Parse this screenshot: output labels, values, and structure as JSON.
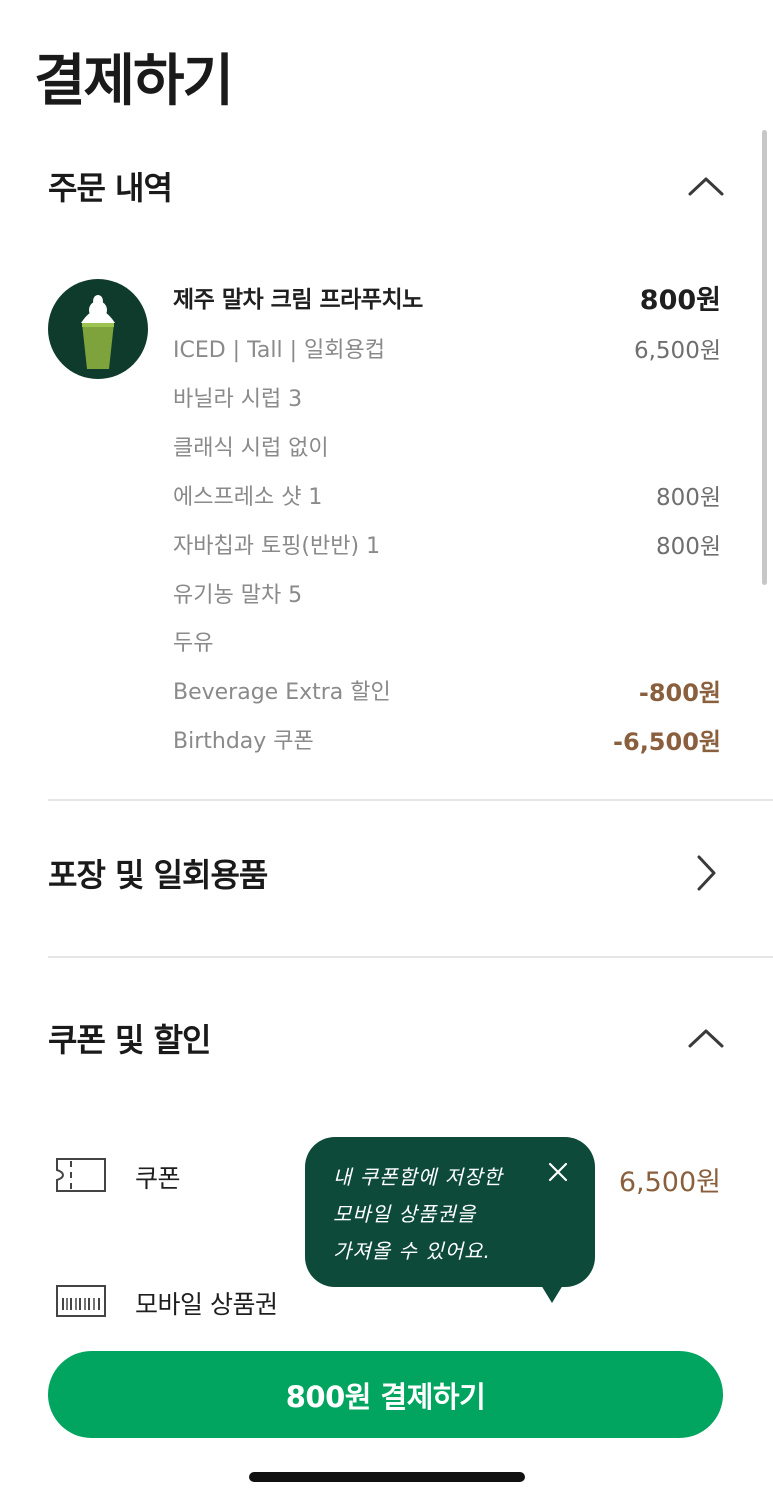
{
  "page": {
    "title": "결제하기"
  },
  "order_section": {
    "title": "주문 내역",
    "item": {
      "name": "제주 말차 크림 프라푸치노",
      "price": "800원",
      "image_icon": "matcha-frappuccino-image"
    },
    "options": [
      {
        "label": "ICED | Tall | 일회용컵",
        "value": "6,500원",
        "type": "normal"
      },
      {
        "label": "바닐라 시럽 3",
        "value": "",
        "type": "normal"
      },
      {
        "label": "클래식 시럽 없이",
        "value": "",
        "type": "normal"
      },
      {
        "label": "에스프레소 샷 1",
        "value": "800원",
        "type": "normal"
      },
      {
        "label": "자바칩과 토핑(반반) 1",
        "value": "800원",
        "type": "normal"
      },
      {
        "label": "유기농 말차 5",
        "value": "",
        "type": "normal"
      },
      {
        "label": "두유",
        "value": "",
        "type": "normal"
      },
      {
        "label": "Beverage Extra 할인",
        "value": "-800원",
        "type": "discount"
      },
      {
        "label": "Birthday 쿠폰",
        "value": "-6,500원",
        "type": "discount"
      }
    ]
  },
  "packaging_section": {
    "title": "포장 및 일회용품"
  },
  "coupon_section": {
    "title": "쿠폰 및 할인",
    "rows": [
      {
        "label": "쿠폰",
        "value": "6,500원",
        "icon": "coupon-ticket-icon"
      },
      {
        "label": "모바일 상품권",
        "icon": "gift-card-icon"
      }
    ],
    "tooltip": {
      "lines": [
        "내 쿠폰함에 저장한",
        "모바일 상품권을",
        "가져올 수 있어요."
      ]
    }
  },
  "pay_button": {
    "label": "800원 결제하기"
  },
  "colors": {
    "brand_green": "#01a560",
    "tooltip_green": "#0d4a3a",
    "discount_brown": "#8a5f3d"
  }
}
